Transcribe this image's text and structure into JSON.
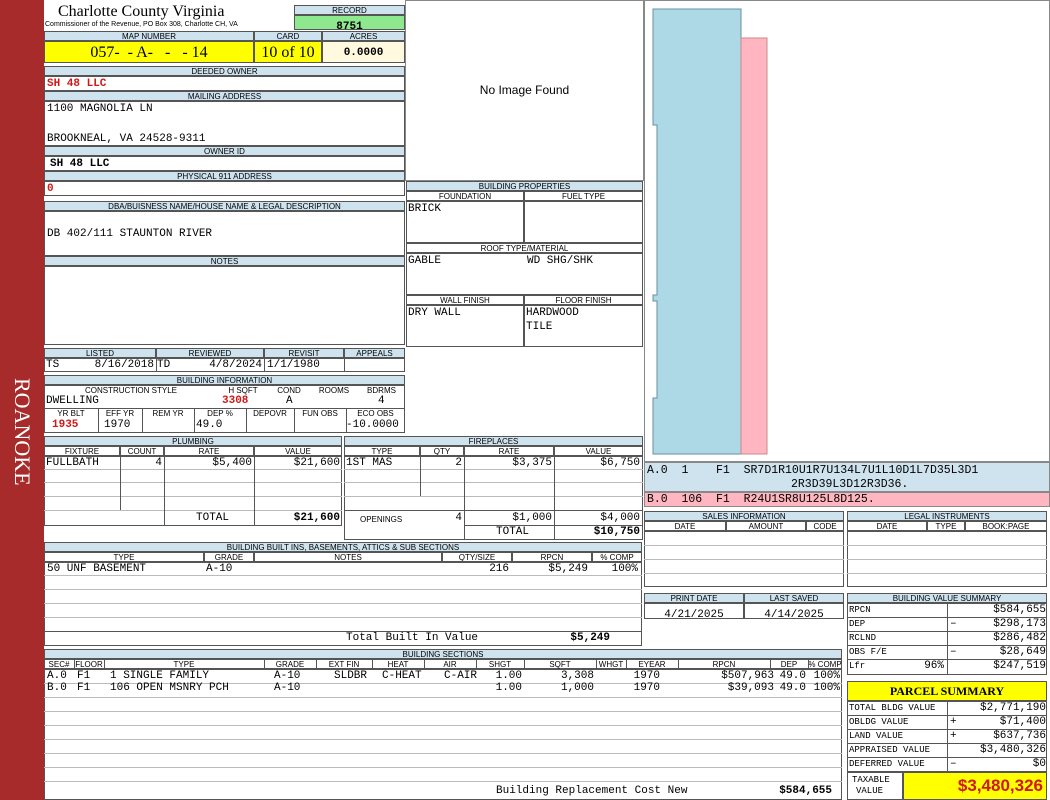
{
  "side_label": "ROANOKE",
  "header": {
    "county": "Charlotte County Virginia",
    "commissioner": "Commissioner of the Revenue, PO Box 308, Charlotte CH, VA",
    "record_label": "RECORD",
    "record": "8751",
    "map_label": "MAP NUMBER",
    "map_number": "057-  - A-   -   - 14",
    "card_label": "CARD",
    "card": "10 of 10",
    "acres_label": "ACRES",
    "acres": "0.0000"
  },
  "owner": {
    "deeded_label": "DEEDED OWNER",
    "deeded": "SH 48 LLC",
    "mailing_label": "MAILING ADDRESS",
    "mail1": "1100 MAGNOLIA LN",
    "mail2": "BROOKNEAL, VA 24528-9311",
    "owner_id_label": "OWNER ID",
    "owner_id": "SH 48 LLC",
    "phys_label": "PHYSICAL 911 ADDRESS",
    "phys": "0",
    "dba_label": "DBA/BUISNESS NAME/HOUSE NAME & LEGAL DESCRIPTION",
    "dba": "DB 402/111 STAUNTON RIVER",
    "notes_label": "NOTES"
  },
  "photo": {
    "text": "No Image Found"
  },
  "listed": {
    "listed_label": "LISTED",
    "listed_by": "TS",
    "listed_date": "8/16/2018",
    "reviewed_label": "REVIEWED",
    "reviewed_by": "TD",
    "reviewed_date": "4/8/2024",
    "revisit_label": "REVISIT",
    "revisit": "1/1/1980",
    "appeals_label": "APPEALS"
  },
  "bldg_info": {
    "title": "BUILDING INFORMATION",
    "style_label": "CONSTRUCTION STYLE",
    "style": "DWELLING",
    "hsqft_label": "H SQFT",
    "hsqft": "3308",
    "cond_label": "COND",
    "cond": "A",
    "rooms_label": "ROOMS",
    "bdrms_label": "BDRMS",
    "bdrms": "4",
    "yrblt_label": "YR BLT",
    "yrblt": "1935",
    "effyr_label": "EFF YR",
    "effyr": "1970",
    "remyr_label": "REM YR",
    "dep_label": "DEP %",
    "dep": "49.0",
    "depovr_label": "DEPOVR",
    "funobs_label": "FUN OBS",
    "ecoobs_label": "ECO OBS",
    "ecoobs": "-10.0000"
  },
  "bldg_props": {
    "title": "BUILDING PROPERTIES",
    "foundation_label": "FOUNDATION",
    "foundation": "BRICK",
    "fuel_label": "FUEL TYPE",
    "roof_label": "ROOF TYPE/MATERIAL",
    "roof1": "GABLE",
    "roof2": "WD SHG/SHK",
    "wall_label": "WALL FINISH",
    "wall": "DRY WALL",
    "floor_label": "FLOOR FINISH",
    "floor1": "HARDWOOD",
    "floor2": "TILE"
  },
  "plumbing": {
    "title": "PLUMBING",
    "h_fixture": "FIXTURE",
    "h_count": "COUNT",
    "h_rate": "RATE",
    "h_value": "VALUE",
    "fixture": "FULLBATH",
    "count": "4",
    "rate": "$5,400",
    "value": "$21,600",
    "total_label": "TOTAL",
    "total": "$21,600"
  },
  "fireplaces": {
    "title": "FIREPLACES",
    "h_type": "TYPE",
    "h_qty": "QTY",
    "h_rate": "RATE",
    "h_value": "VALUE",
    "type": "1ST MAS",
    "qty": "2",
    "rate": "$3,375",
    "value": "$6,750",
    "openings_label": "OPENINGS",
    "open_qty": "4",
    "open_rate": "$1,000",
    "open_value": "$4,000",
    "total_label": "TOTAL",
    "total": "$10,750"
  },
  "sketch": {
    "line1": "A.0  1    F1  SR7D1R10U1R7U134L7U1L10D1L7D35L3D1",
    "line1b": "2R3D39L3D12R3D36.",
    "line2": "B.0  106  F1  R24U1SR8U125L8D125."
  },
  "sales": {
    "title": "SALES INFORMATION",
    "h_date": "DATE",
    "h_amount": "AMOUNT",
    "h_code": "CODE"
  },
  "legal": {
    "title": "LEGAL INSTRUMENTS",
    "h_date": "DATE",
    "h_type": "TYPE",
    "h_book": "BOOK:PAGE"
  },
  "builtins": {
    "title": "BUILDING BUILT INS, BASEMENTS, ATTICS & SUB SECTIONS",
    "h_type": "TYPE",
    "h_grade": "GRADE",
    "h_notes": "NOTES",
    "h_qty": "QTY/SIZE",
    "h_rpcn": "RPCN",
    "h_comp": "% COMP",
    "type": "50 UNF BASEMENT",
    "grade": "A-10",
    "qty": "216",
    "rpcn": "$5,249",
    "comp": "100%",
    "total_label": "Total Built In Value",
    "total": "$5,249"
  },
  "dates": {
    "print_label": "PRINT DATE",
    "print": "4/21/2025",
    "saved_label": "LAST SAVED",
    "saved": "4/14/2025"
  },
  "value_summary": {
    "title": "BUILDING VALUE SUMMARY",
    "rpcn_label": "RPCN",
    "rpcn": "$584,655",
    "dep_label": "DEP",
    "dep_sign": "–",
    "dep": "$298,173",
    "rclnd_label": "RCLND",
    "rclnd": "$286,482",
    "obs_label": "OBS F/E",
    "obs_sign": "–",
    "obs": "$28,649",
    "lfr_label": "Lfr",
    "lfr_pct": "96%",
    "lfr": "$247,519"
  },
  "sections": {
    "title": "BUILDING SECTIONS",
    "headers": [
      "SEC#",
      "FLOOR",
      "TYPE",
      "GRADE",
      "EXT FIN",
      "HEAT",
      "AIR",
      "SHGT",
      "SQFT",
      "WHGT",
      "EYEAR",
      "RPCN",
      "DEP",
      "% COMP"
    ],
    "rows": [
      [
        "A.0",
        "F1",
        "1 SINGLE FAMILY",
        "A-10",
        "SLDBR",
        "C-HEAT",
        "C-AIR",
        "1.00",
        "3,308",
        "",
        "1970",
        "$507,963",
        "49.0",
        "100%"
      ],
      [
        "B.0",
        "F1",
        "106 OPEN MSNRY PCH",
        "A-10",
        "",
        "",
        "",
        "1.00",
        "1,000",
        "",
        "1970",
        "$39,093",
        "49.0",
        "100%"
      ]
    ],
    "footer_label": "Building Replacement Cost New",
    "footer": "$584,655"
  },
  "parcel": {
    "title": "PARCEL SUMMARY",
    "bldg_label": "TOTAL BLDG VALUE",
    "bldg": "$2,771,190",
    "obldg_label": "OBLDG VALUE",
    "obldg_sign": "+",
    "obldg": "$71,400",
    "land_label": "LAND VALUE",
    "land_sign": "+",
    "land": "$637,736",
    "appr_label": "APPRAISED VALUE",
    "appr": "$3,480,326",
    "def_label": "DEFERRED VALUE",
    "def_sign": "–",
    "def": "$0",
    "tax_label1": "TAXABLE",
    "tax_label2": "VALUE",
    "tax": "$3,480,326"
  },
  "colors": {
    "sidebar": "#a72b2b",
    "header_bg": "#cfe3ef",
    "highlight": "#ffff00",
    "record_bg": "#8ee88e",
    "sketch_a": "#add8e6",
    "sketch_b": "#ffb6c1",
    "value_red": "#d01818"
  }
}
